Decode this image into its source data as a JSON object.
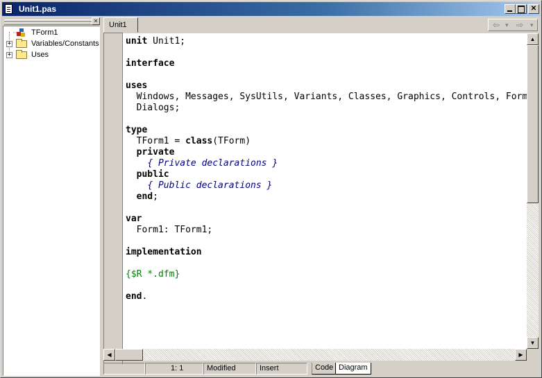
{
  "window": {
    "title": "Unit1.pas"
  },
  "explorer": {
    "close_label": "×",
    "items": [
      {
        "label": "TForm1",
        "expand": ""
      },
      {
        "label": "Variables/Constants",
        "expand": "+"
      },
      {
        "label": "Uses",
        "expand": "+"
      }
    ]
  },
  "editor": {
    "tab_label": "Unit1",
    "nav_back": "⇦",
    "nav_forward": "⇨",
    "nav_dropdown": "▾"
  },
  "code_lines": [
    "unit Unit1;",
    "",
    "interface",
    "",
    "uses",
    "  Windows, Messages, SysUtils, Variants, Classes, Graphics, Controls, Forms,",
    "  Dialogs;",
    "",
    "type",
    "  TForm1 = class(TForm)",
    "  private",
    "    { Private declarations }",
    "  public",
    "    { Public declarations }",
    "  end;",
    "",
    "var",
    "  Form1: TForm1;",
    "",
    "implementation",
    "",
    "{$R *.dfm}",
    "",
    "end."
  ],
  "status": {
    "position": "1:   1",
    "modified": "Modified",
    "mode": "Insert",
    "tabs": [
      "Code",
      "Diagram"
    ]
  },
  "colors": {
    "comment": "#000080",
    "directive": "#008000",
    "titlebar_start": "#0a246a"
  },
  "icons": {
    "title": "document-icon",
    "tree_root": "form-icon",
    "tree_folder": "folder-icon"
  }
}
